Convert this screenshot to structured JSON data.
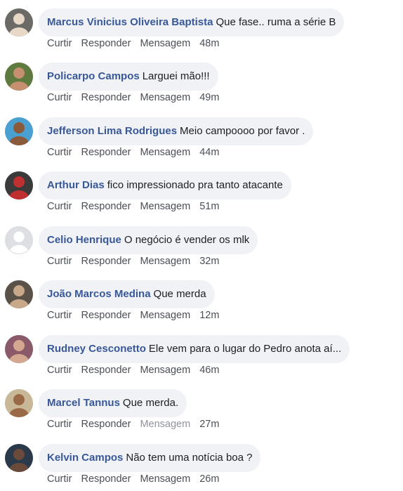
{
  "actions": {
    "like": "Curtir",
    "reply": "Responder",
    "message": "Mensagem"
  },
  "comments": [
    {
      "author": "Marcus Vinicius Oliveira Baptista",
      "text": "Que fase.. ruma a série B",
      "time": "48m",
      "avatar_bg": "#6b6a66",
      "avatar_fg": "#e8d8c8"
    },
    {
      "author": "Policarpo Campos",
      "text": "Larguei mão!!!",
      "time": "49m",
      "avatar_bg": "#5f7a3e",
      "avatar_fg": "#c69070"
    },
    {
      "author": "Jefferson Lima Rodrigues",
      "text": "Meio campoooo por favor .",
      "time": "44m",
      "avatar_bg": "#4aa0d0",
      "avatar_fg": "#8a5a3a"
    },
    {
      "author": "Arthur Dias",
      "text": "fico impressionado pra tanto atacante",
      "time": "51m",
      "avatar_bg": "#3a3a3a",
      "avatar_fg": "#c03030"
    },
    {
      "author": "Celio Henrique",
      "text": "O negócio é vender os mlk",
      "time": "32m",
      "avatar_bg": "#dddfe2",
      "avatar_fg": "#ffffff"
    },
    {
      "author": "João Marcos Medina",
      "text": "Que merda",
      "time": "12m",
      "avatar_bg": "#5a5248",
      "avatar_fg": "#c8a888"
    },
    {
      "author": "Rudney Cesconetto",
      "text": "Ele vem para o lugar do Pedro anota aí...",
      "time": "46m",
      "avatar_bg": "#8a5a6a",
      "avatar_fg": "#d4a890"
    },
    {
      "author": "Marcel Tannus",
      "text": "Que merda.",
      "time": "27m",
      "avatar_bg": "#c8b898",
      "avatar_fg": "#9a6a48"
    },
    {
      "author": "Kelvin Campos",
      "text": "Não tem uma notícia boa ?",
      "time": "26m",
      "avatar_bg": "#2a3a4a",
      "avatar_fg": "#6a4a3a"
    }
  ]
}
